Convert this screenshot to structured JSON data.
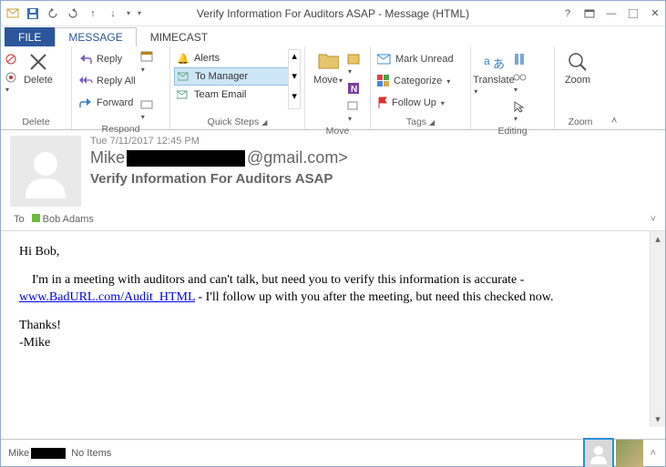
{
  "window": {
    "title": "Verify Information For Auditors ASAP - Message (HTML)"
  },
  "tabs": {
    "file": "FILE",
    "message": "MESSAGE",
    "mimecast": "MIMECAST"
  },
  "ribbon": {
    "delete": {
      "label": "Delete",
      "group": "Delete"
    },
    "respond": {
      "reply": "Reply",
      "reply_all": "Reply All",
      "forward": "Forward",
      "group": "Respond"
    },
    "quicksteps": {
      "alerts": "Alerts",
      "to_manager": "To Manager",
      "team_email": "Team Email",
      "group": "Quick Steps"
    },
    "move": {
      "label": "Move",
      "group": "Move"
    },
    "tags": {
      "mark_unread": "Mark Unread",
      "categorize": "Categorize",
      "follow_up": "Follow Up",
      "group": "Tags"
    },
    "editing": {
      "translate": "Translate",
      "group": "Editing"
    },
    "zoom": {
      "label": "Zoom",
      "group": "Zoom"
    }
  },
  "header": {
    "sent": "Tue 7/11/2017 12:45 PM",
    "from_name": "Mike",
    "from_domain": "@gmail.com>",
    "subject": "Verify Information For Auditors ASAP",
    "to_label": "To",
    "to_name": "Bob Adams"
  },
  "body": {
    "greeting": "Hi Bob,",
    "line1a": "I'm in a meeting with auditors and can't talk, but need you to verify this information is accurate - ",
    "link": "www.BadURL.com/Audit_HTML",
    "line1b": " - I'll follow up with you after the meeting, but need this checked now.",
    "thanks": "Thanks!",
    "sig": "-Mike"
  },
  "status": {
    "user": "Mike",
    "items": "No Items"
  }
}
